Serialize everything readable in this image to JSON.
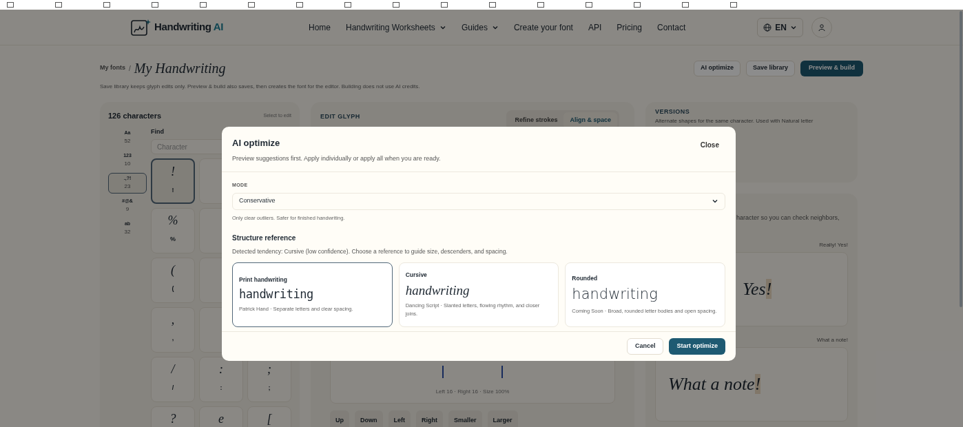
{
  "header": {
    "logo": {
      "word": "Handwriting",
      "accent": "AI"
    },
    "nav": [
      {
        "label": "Home",
        "dropdown": false
      },
      {
        "label": "Handwriting Worksheets",
        "dropdown": true
      },
      {
        "label": "Guides",
        "dropdown": true
      },
      {
        "label": "Create your font",
        "dropdown": false
      },
      {
        "label": "API",
        "dropdown": false
      },
      {
        "label": "Pricing",
        "dropdown": false
      },
      {
        "label": "Contact",
        "dropdown": false
      }
    ],
    "language": "EN"
  },
  "toolbar": {
    "breadcrumb": "My fonts",
    "separator": "/",
    "title": "My Handwriting",
    "actions": [
      {
        "label": "AI optimize",
        "kind": "secondary"
      },
      {
        "label": "Save library",
        "kind": "secondary"
      },
      {
        "label": "Preview & build",
        "kind": "primary"
      }
    ],
    "note": "Save library keeps glyph edits only. Preview & build also saves, then creates the font for the editor. Building does not use AI credits."
  },
  "characters": {
    "title": "126 characters",
    "hint": "Select to edit",
    "categories": [
      {
        "label": "Aa",
        "count": "52",
        "selected": false
      },
      {
        "label": "123",
        "count": "10",
        "selected": false
      },
      {
        "label": ".,?!",
        "count": "23",
        "selected": true
      },
      {
        "label": "#@&",
        "count": "9",
        "selected": false
      },
      {
        "label": "ab",
        "count": "32",
        "selected": false
      }
    ],
    "find_label": "Find",
    "find_placeholder": "Character",
    "rows": [
      [
        {
          "glyph": "!",
          "label": "!",
          "selected": true
        }
      ],
      [
        {
          "glyph": "%",
          "label": "%",
          "selected": false
        }
      ],
      [
        {
          "glyph": "(",
          "label": "(",
          "selected": false
        }
      ],
      [
        {
          "glyph": ",",
          "label": ",",
          "selected": false
        }
      ],
      [
        {
          "glyph": "/",
          "label": "/",
          "selected": false
        },
        {
          "glyph": ":",
          "label": ":",
          "selected": false
        },
        {
          "glyph": ";",
          "label": ";",
          "selected": false
        }
      ],
      [
        {
          "glyph": "?",
          "selected": false
        },
        {
          "glyph": "e",
          "selected": false
        },
        {
          "glyph": "[",
          "selected": false
        }
      ]
    ]
  },
  "editor": {
    "section": "EDIT GLYPH",
    "tabs": [
      {
        "label": "Refine strokes",
        "selected": false
      },
      {
        "label": "Align & space",
        "selected": true
      }
    ],
    "metrics": "Left 16 · Right 16 · Size 100%",
    "buttons": [
      "Up",
      "Down",
      "Left",
      "Right",
      "Smaller",
      "Larger"
    ]
  },
  "versions": {
    "title": "VERSIONS",
    "description": "Alternate shapes for the same character. Used with Natural letter"
  },
  "preview": {
    "description": "haracter so you can check neighbors,",
    "samples": [
      {
        "caption": "Really! Yes!",
        "text": "Yes",
        "highlight": "!"
      },
      {
        "caption": "What a note!",
        "text": "What a note",
        "highlight": "!"
      }
    ]
  },
  "modal": {
    "title": "AI optimize",
    "subtitle": "Preview suggestions first. Apply individually or apply all when you are ready.",
    "close": "Close",
    "mode_label": "MODE",
    "mode_value": "Conservative",
    "mode_hint": "Only clear outliers. Safer for finished handwriting.",
    "structure_title": "Structure reference",
    "structure_description": "Detected tendency: Cursive (low confidence). Choose a reference to guide size, descenders, and spacing.",
    "references": [
      {
        "name": "Print handwriting",
        "sample": "handwriting",
        "description": "Patrick Hand · Separate letters and clear spacing.",
        "kind": "print",
        "selected": true
      },
      {
        "name": "Cursive",
        "sample": "handwriting",
        "description": "Dancing Script · Slanted letters, flowing rhythm, and closer joins.",
        "kind": "cursive",
        "selected": false
      },
      {
        "name": "Rounded",
        "sample": "handwriting",
        "description": "Coming Soon · Broad, rounded letter bodies and open spacing.",
        "kind": "rounded",
        "selected": false
      }
    ],
    "cancel": "Cancel",
    "confirm": "Start optimize"
  }
}
